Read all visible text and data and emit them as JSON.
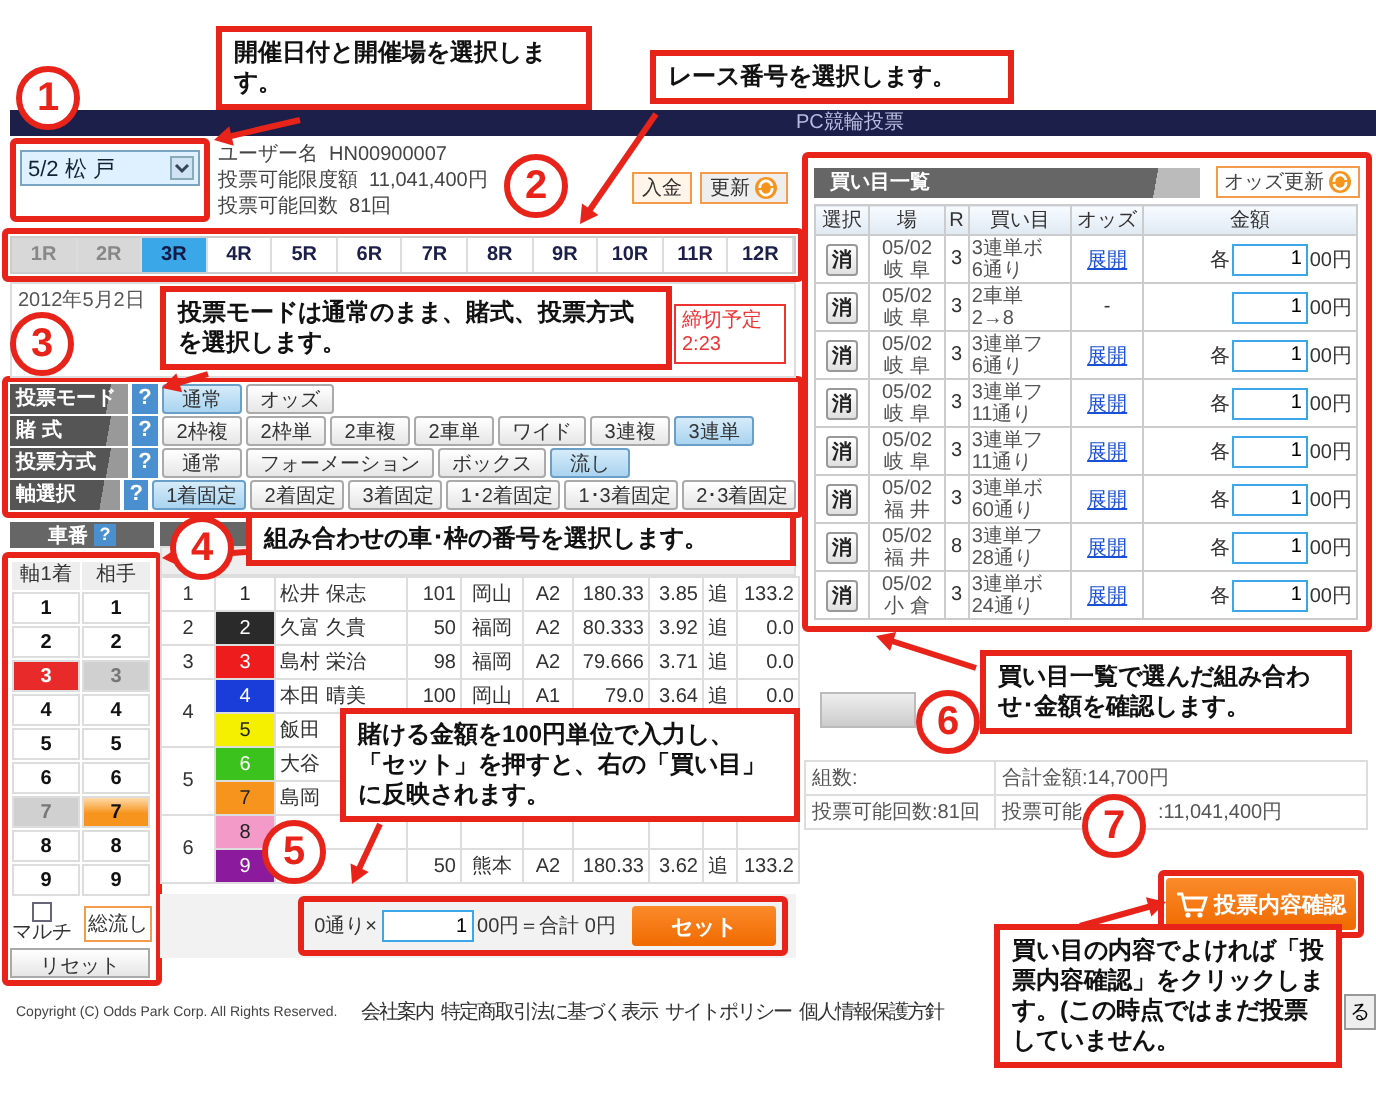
{
  "header": {
    "title": "PC競輪投票"
  },
  "venue_select": {
    "value": "5/2 松 戸"
  },
  "account": [
    {
      "label": "ユーザー名",
      "value": "HN00900007"
    },
    {
      "label": "投票可能限度額",
      "value": "11,041,400円"
    },
    {
      "label": "投票可能回数",
      "value": "81回"
    }
  ],
  "account_buttons": [
    {
      "label": "入金",
      "kind": "plain"
    },
    {
      "label": "更新",
      "kind": "refresh"
    }
  ],
  "race_tabs": [
    {
      "label": "1R",
      "disabled": true,
      "selected": false
    },
    {
      "label": "2R",
      "disabled": true,
      "selected": false
    },
    {
      "label": "3R",
      "disabled": false,
      "selected": true
    },
    {
      "label": "4R",
      "disabled": false,
      "selected": false
    },
    {
      "label": "5R",
      "disabled": false,
      "selected": false
    },
    {
      "label": "6R",
      "disabled": false,
      "selected": false
    },
    {
      "label": "7R",
      "disabled": false,
      "selected": false
    },
    {
      "label": "8R",
      "disabled": false,
      "selected": false
    },
    {
      "label": "9R",
      "disabled": false,
      "selected": false
    },
    {
      "label": "10R",
      "disabled": false,
      "selected": false
    },
    {
      "label": "11R",
      "disabled": false,
      "selected": false
    },
    {
      "label": "12R",
      "disabled": false,
      "selected": false
    }
  ],
  "race_info": {
    "date": "2012年5月2日",
    "deadline_label": "締切予定",
    "deadline_time": "2:23"
  },
  "bet_options": [
    {
      "label": "投票モード",
      "help": "?",
      "options": [
        {
          "label": "通常",
          "selected": true
        },
        {
          "label": "オッズ",
          "selected": false
        }
      ]
    },
    {
      "label": "賭 式",
      "help": "?",
      "options": [
        {
          "label": "2枠複",
          "selected": false
        },
        {
          "label": "2枠単",
          "selected": false
        },
        {
          "label": "2車複",
          "selected": false
        },
        {
          "label": "2車単",
          "selected": false
        },
        {
          "label": "ワイド",
          "selected": false
        },
        {
          "label": "3連複",
          "selected": false
        },
        {
          "label": "3連単",
          "selected": true
        }
      ]
    },
    {
      "label": "投票方式",
      "help": "?",
      "options": [
        {
          "label": "通常",
          "selected": false
        },
        {
          "label": "フォーメーション",
          "selected": false
        },
        {
          "label": "ボックス",
          "selected": false
        },
        {
          "label": "流し",
          "selected": true
        }
      ]
    },
    {
      "label": "軸選択",
      "help": "?",
      "options": [
        {
          "label": "1着固定",
          "selected": true
        },
        {
          "label": "2着固定",
          "selected": false
        },
        {
          "label": "3着固定",
          "selected": false
        },
        {
          "label": "1･2着固定",
          "selected": false
        },
        {
          "label": "1･3着固定",
          "selected": false
        },
        {
          "label": "2･3着固定",
          "selected": false
        }
      ]
    }
  ],
  "car_picker": {
    "title": "車番",
    "help": "?",
    "columns": [
      "軸1着",
      "相手"
    ],
    "numbers": [
      {
        "axis": {
          "label": "1",
          "selected": false,
          "disabled": false
        },
        "partner": {
          "label": "1",
          "selected": false,
          "disabled": false
        }
      },
      {
        "axis": {
          "label": "2",
          "selected": false,
          "disabled": false
        },
        "partner": {
          "label": "2",
          "selected": false,
          "disabled": false
        }
      },
      {
        "axis": {
          "label": "3",
          "selected": true,
          "disabled": false
        },
        "partner": {
          "label": "3",
          "selected": false,
          "disabled": true
        }
      },
      {
        "axis": {
          "label": "4",
          "selected": false,
          "disabled": false
        },
        "partner": {
          "label": "4",
          "selected": false,
          "disabled": false
        }
      },
      {
        "axis": {
          "label": "5",
          "selected": false,
          "disabled": false
        },
        "partner": {
          "label": "5",
          "selected": false,
          "disabled": false
        }
      },
      {
        "axis": {
          "label": "6",
          "selected": false,
          "disabled": false
        },
        "partner": {
          "label": "6",
          "selected": false,
          "disabled": false
        }
      },
      {
        "axis": {
          "label": "7",
          "selected": false,
          "disabled": true
        },
        "partner": {
          "label": "7",
          "selected": true,
          "disabled": false
        }
      },
      {
        "axis": {
          "label": "8",
          "selected": false,
          "disabled": false
        },
        "partner": {
          "label": "8",
          "selected": false,
          "disabled": false
        }
      },
      {
        "axis": {
          "label": "9",
          "selected": false,
          "disabled": false
        },
        "partner": {
          "label": "9",
          "selected": false,
          "disabled": false
        }
      }
    ],
    "multi": {
      "label": "マルチ",
      "checked": false
    },
    "all_flow": "総流し",
    "reset": "リセット"
  },
  "entry_table": {
    "frames": [
      {
        "frame": "1",
        "riders": [
          {
            "car": "1",
            "color": "#ffffff",
            "name": "松井 保志",
            "cells": [
              "101",
              "岡山",
              "A2",
              "180.33",
              "3.85",
              "追",
              "133.2"
            ]
          }
        ]
      },
      {
        "frame": "2",
        "riders": [
          {
            "car": "2",
            "color": "#2a2a2a",
            "name": "久富 久貴",
            "cells": [
              "50",
              "福岡",
              "A2",
              "80.333",
              "3.92",
              "追",
              "0.0"
            ]
          }
        ]
      },
      {
        "frame": "3",
        "riders": [
          {
            "car": "3",
            "color": "#ee1c1c",
            "name": "島村 栄治",
            "cells": [
              "98",
              "福岡",
              "A2",
              "79.666",
              "3.71",
              "追",
              "0.0"
            ]
          }
        ]
      },
      {
        "frame": "4",
        "riders": [
          {
            "car": "4",
            "color": "#1a3cd8",
            "name": "本田 晴美",
            "cells": [
              "100",
              "岡山",
              "A1",
              "79.0",
              "3.64",
              "追",
              "0.0"
            ]
          },
          {
            "car": "5",
            "color": "#f4f000",
            "name": "飯田"
          }
        ]
      },
      {
        "frame": "5",
        "riders": [
          {
            "car": "6",
            "color": "#3cc21c",
            "name": "大谷"
          },
          {
            "car": "7",
            "color": "#f7941d",
            "name": "島岡"
          }
        ]
      },
      {
        "frame": "6",
        "riders": [
          {
            "car": "8",
            "color": "#f49ac8"
          },
          {
            "car": "9",
            "color": "#8b1a9c",
            "cells": [
              "50",
              "熊本",
              "A2",
              "180.33",
              "3.62",
              "追",
              "133.2"
            ]
          }
        ]
      }
    ]
  },
  "bet_bar": {
    "prefix": "0通り×",
    "amount": "1",
    "suffix": "00円＝合計 0円",
    "button": "セット"
  },
  "footer": {
    "copyright": "Copyright (C) Odds Park Corp. All Rights Reserved.",
    "links": [
      "会社案内",
      "特定商取引法に基づく表示",
      "サイトポリシー",
      "個人情報保護方針"
    ],
    "back_button": "る"
  },
  "selection_list": {
    "title": "買い目一覧",
    "odds_button": "オッズ更新",
    "columns": [
      "選択",
      "場",
      "R",
      "買い目",
      "オッズ",
      "金額"
    ],
    "rows": [
      {
        "delete": "消",
        "date": "05/02",
        "venue": "岐 阜",
        "race": "3",
        "bet": "3連単ボ",
        "count": "6通り",
        "odds": {
          "kind": "link",
          "text": "展開"
        },
        "each": "各",
        "amount": "1",
        "unit": "00円"
      },
      {
        "delete": "消",
        "date": "05/02",
        "venue": "岐 阜",
        "race": "3",
        "bet": "2車単",
        "count": "2→8",
        "odds": {
          "kind": "text",
          "text": "-"
        },
        "amount": "1",
        "unit": "00円"
      },
      {
        "delete": "消",
        "date": "05/02",
        "venue": "岐 阜",
        "race": "3",
        "bet": "3連単フ",
        "count": "6通り",
        "odds": {
          "kind": "link",
          "text": "展開"
        },
        "each": "各",
        "amount": "1",
        "unit": "00円"
      },
      {
        "delete": "消",
        "date": "05/02",
        "venue": "岐 阜",
        "race": "3",
        "bet": "3連単フ",
        "count": "11通り",
        "odds": {
          "kind": "link",
          "text": "展開"
        },
        "each": "各",
        "amount": "1",
        "unit": "00円"
      },
      {
        "delete": "消",
        "date": "05/02",
        "venue": "岐 阜",
        "race": "3",
        "bet": "3連単フ",
        "count": "11通り",
        "odds": {
          "kind": "link",
          "text": "展開"
        },
        "each": "各",
        "amount": "1",
        "unit": "00円"
      },
      {
        "delete": "消",
        "date": "05/02",
        "venue": "福 井",
        "race": "3",
        "bet": "3連単ボ",
        "count": "60通り",
        "odds": {
          "kind": "link",
          "text": "展開"
        },
        "each": "各",
        "amount": "1",
        "unit": "00円"
      },
      {
        "delete": "消",
        "date": "05/02",
        "venue": "福 井",
        "race": "8",
        "bet": "3連単フ",
        "count": "28通り",
        "odds": {
          "kind": "link",
          "text": "展開"
        },
        "each": "各",
        "amount": "1",
        "unit": "00円"
      },
      {
        "delete": "消",
        "date": "05/02",
        "venue": "小 倉",
        "race": "3",
        "bet": "3連単ボ",
        "count": "24通り",
        "odds": {
          "kind": "link",
          "text": "展開"
        },
        "each": "各",
        "amount": "1",
        "unit": "00円"
      }
    ]
  },
  "selection_summary": [
    [
      {
        "parts": [
          "組数:"
        ]
      },
      {
        "parts": [
          "合計金額:14,700円"
        ]
      }
    ],
    [
      {
        "parts": [
          "投票可能回数:81回"
        ]
      },
      {
        "parts": [
          "投票可能",
          ":11,041,400円"
        ]
      }
    ]
  ],
  "confirm_button": "投票内容確認",
  "callouts": [
    {
      "number": "1",
      "text": "開催日付と開催場を選択します。"
    },
    {
      "number": "2",
      "text": "レース番号を選択します。"
    },
    {
      "number": "3",
      "text": "投票モードは通常のまま、賭式、投票方式を選択します。"
    },
    {
      "number": "4",
      "text": "組み合わせの車･枠の番号を選択します。"
    },
    {
      "number": "5",
      "text": "賭ける金額を100円単位で入力し、「セット」を押すと、右の「買い目」に反映されます。"
    },
    {
      "number": "6",
      "text": "買い目一覧で選んだ組み合わせ･金額を確認します。"
    },
    {
      "number": "7",
      "text": "買い目の内容でよければ「投票内容確認」をクリックします。(この時点ではまだ投票していません。"
    }
  ]
}
